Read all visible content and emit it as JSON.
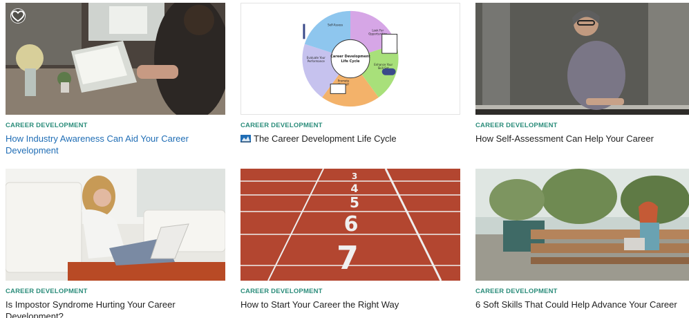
{
  "cards": [
    {
      "category": "CAREER DEVELOPMENT",
      "title": "How Industry Awareness Can Aid Your Career Development",
      "image": "person-typing-on-laptop"
    },
    {
      "category": "CAREER DEVELOPMENT",
      "title": "The Career Development Life Cycle",
      "image": "career-development-life-cycle-diagram",
      "diagram": {
        "center": "Career Development Life Cycle",
        "segments": [
          "Self-Assess",
          "Look For Opportunities",
          "Enhance Your Skill Set",
          "Promote Yourself",
          "Evaluate Your Performance"
        ]
      }
    },
    {
      "category": "CAREER DEVELOPMENT",
      "title": "How Self-Assessment Can Help Your Career",
      "image": "woman-on-balcony"
    },
    {
      "category": "CAREER DEVELOPMENT",
      "title": "Is Impostor Syndrome Hurting Your Career Development?",
      "image": "woman-with-laptop-on-floor"
    },
    {
      "category": "CAREER DEVELOPMENT",
      "title": "How to Start Your Career the Right Way",
      "image": "running-track-lanes",
      "lane_numbers": [
        "3",
        "4",
        "5",
        "6",
        "7"
      ]
    },
    {
      "category": "CAREER DEVELOPMENT",
      "title": "6 Soft Skills That Could Help Advance Your Career",
      "image": "woman-on-park-bench"
    }
  ],
  "colors": {
    "category": "#2a8c7a",
    "link_active": "#1f6db5"
  },
  "icons": {
    "favorite": "heart-icon",
    "type_badge": "chart-icon"
  }
}
